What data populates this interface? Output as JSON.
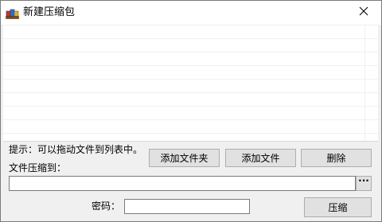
{
  "window": {
    "title": "新建压缩包",
    "app_icon": "archive-icon",
    "close_icon": "close-icon"
  },
  "file_list": {
    "items": []
  },
  "hint": {
    "text": "提示：可以拖动文件到列表中。"
  },
  "buttons": {
    "add_folder": "添加文件夹",
    "add_file": "添加文件",
    "delete": "删除",
    "browse": "···",
    "compress": "压缩"
  },
  "compress_to": {
    "label": "文件压缩到：",
    "value": ""
  },
  "password": {
    "label": "密码：",
    "value": ""
  }
}
